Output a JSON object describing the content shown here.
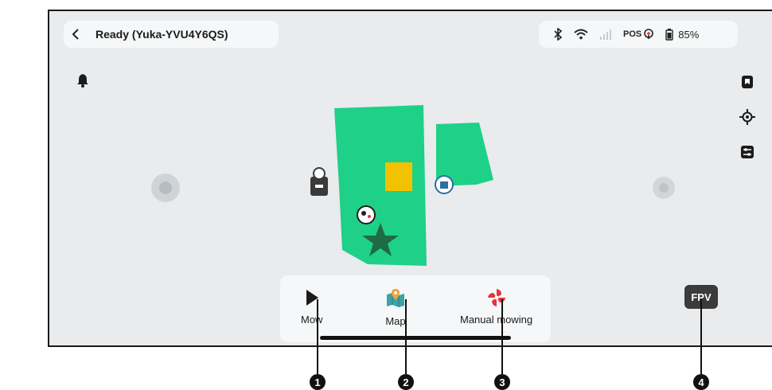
{
  "header": {
    "status_title": "Ready  (Yuka-YVU4Y6QS)",
    "pos_label": "POS",
    "battery_percent": "85%"
  },
  "icons": {
    "back": "chevron-left-icon",
    "bluetooth": "bluetooth-icon",
    "wifi": "wifi-icon",
    "cellular": "cellular-signal-icon",
    "pos": "antenna-icon",
    "battery": "battery-icon",
    "bell": "bell-icon",
    "side_tools": [
      "map-bookmark-icon",
      "locate-icon",
      "settings-sliders-icon"
    ]
  },
  "bottom_bar": {
    "items": [
      {
        "label": "Mow",
        "icon": "play-icon"
      },
      {
        "label": "Map",
        "icon": "map-icon"
      },
      {
        "label": "Manual mowing",
        "icon": "blade-icon"
      }
    ]
  },
  "fpv_label": "FPV",
  "callouts": [
    "1",
    "2",
    "3",
    "4"
  ],
  "colors": {
    "lawn": "#1fd088",
    "mower_zone": "#f2c200",
    "background": "#e9ebed",
    "panel": "#f6f7f8",
    "accent_red": "#e8343c",
    "callout": "#111111"
  }
}
